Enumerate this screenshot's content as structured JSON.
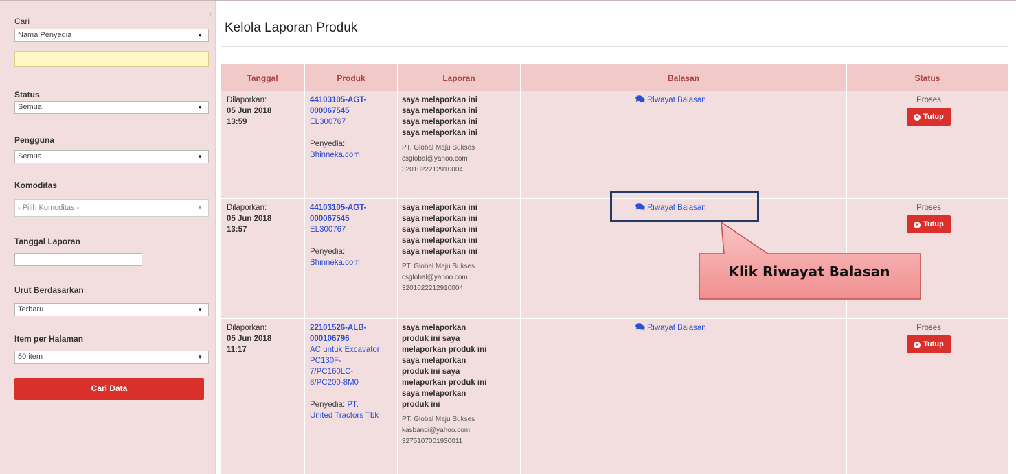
{
  "sidebar": {
    "cari_label": "Cari",
    "cari_select": "Nama Penyedia",
    "search_value": "",
    "status_label": "Status",
    "status_select": "Semua",
    "pengguna_label": "Pengguna",
    "pengguna_select": "Semua",
    "komoditas_label": "Komoditas",
    "komoditas_select": "- Pilih Komoditas -",
    "tanggal_label": "Tanggal Laporan",
    "tanggal_value": "",
    "urut_label": "Urut Berdasarkan",
    "urut_select": "Terbaru",
    "item_label": "Item per Halaman",
    "item_select": "50 item",
    "cari_button": "Cari Data"
  },
  "page": {
    "title": "Kelola Laporan Produk"
  },
  "table": {
    "headers": [
      "Tanggal",
      "Produk",
      "Laporan",
      "Balasan",
      "Status"
    ],
    "rows": [
      {
        "date_label": "Dilaporkan:",
        "date": "05 Jun 2018",
        "time": "13:59",
        "code1": "44103105-AGT-",
        "code2": "000067545",
        "product_name": "EL300767",
        "penyedia_label": "Penyedia:",
        "penyedia": "Bhinneka.com",
        "laporan_lines": [
          "saya melaporkan ini",
          "saya melaporkan ini",
          "saya melaporkan ini",
          "saya melaporkan ini"
        ],
        "company": "PT. Global Maju Sukses",
        "email": "csglobal@yahoo.com",
        "id_number": "3201022212910004",
        "balasan": "Riwayat Balasan",
        "status": "Proses",
        "tutup": "Tutup"
      },
      {
        "date_label": "Dilaporkan:",
        "date": "05 Jun 2018",
        "time": "13:57",
        "code1": "44103105-AGT-",
        "code2": "000067545",
        "product_name": "EL300767",
        "penyedia_label": "Penyedia:",
        "penyedia": "Bhinneka.com",
        "laporan_lines": [
          "saya melaporkan ini",
          "saya melaporkan ini",
          "saya melaporkan ini",
          "saya melaporkan ini",
          "saya melaporkan ini"
        ],
        "company": "PT. Global Maju Sukses",
        "email": "csglobal@yahoo.com",
        "id_number": "3201022212910004",
        "balasan": "Riwayat Balasan",
        "status": "Proses",
        "tutup": "Tutup"
      },
      {
        "date_label": "Dilaporkan:",
        "date": "05 Jun 2018",
        "time": "11:17",
        "code1": "22101526-ALB-",
        "code2": "000106796",
        "product_name_lines": [
          "AC untuk Excavator",
          "PC130F-",
          "7/PC160LC-",
          "8/PC200-8M0"
        ],
        "penyedia_label": "Penyedia:",
        "penyedia_prefix": "PT.",
        "penyedia_rest": "United Tractors Tbk",
        "laporan_lines": [
          "saya melaporkan",
          "produk ini saya",
          "melaporkan produk ini",
          "saya melaporkan",
          "produk ini saya",
          "melaporkan produk ini",
          "saya melaporkan",
          "produk ini"
        ],
        "company": "PT. Global Maju Sukses",
        "email": "kasbandi@yahoo.com",
        "id_number": "3275107001930011",
        "balasan": "Riwayat Balasan",
        "status": "Proses",
        "tutup": "Tutup"
      }
    ]
  },
  "callout": {
    "text": "Klik Riwayat Balasan"
  },
  "colors": {
    "sidebar_bg": "#f2dede",
    "header_bg": "#f2c9c9",
    "header_text": "#a94442",
    "link": "#2a4fd6",
    "danger": "#d9302c",
    "highlight_border": "#1f3b66",
    "callout_fill": "#f7aaaa"
  }
}
